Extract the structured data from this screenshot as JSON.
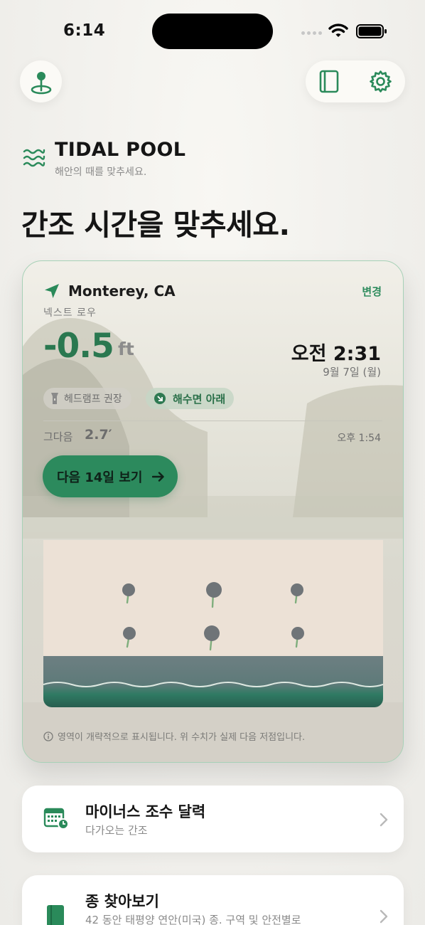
{
  "status_bar": {
    "time": "6:14"
  },
  "brand": {
    "name": "TIDAL POOL",
    "tagline": "해안의 때를 맞추세요."
  },
  "headline": "간조 시간을 맞추세요.",
  "tide_card": {
    "location": "Monterey, CA",
    "change_label": "변경",
    "next_low_label": "넥스트 로우",
    "height_value": "-0.5",
    "height_unit": "ft",
    "low_time": "오전 2:31",
    "low_date": "9월 7일 (월)",
    "chips": {
      "headlamp": "헤드램프 권장",
      "below_sea_level": "해수면 아래"
    },
    "next_label": "그다음",
    "next_height": "2.7′",
    "next_time": "오후 1:54",
    "forecast_button": "다음 14일 보기",
    "note": "영역이 개략적으로 표시됩니다. 위 수치가 실제 다음 저점입니다."
  },
  "list_cards": [
    {
      "title": "마이너스 조수 달력",
      "subtitle": "다가오는 간조",
      "icon": "calendar-clock-icon"
    },
    {
      "title": "종 찾아보기",
      "subtitle": "42 동안 태평양 연안(미국) 종. 구역 및 안전별로",
      "icon": "book-icon"
    }
  ],
  "colors": {
    "accent": "#2c8a5d",
    "accent_dark": "#2a7850",
    "card_border": "#a7d1b7"
  }
}
